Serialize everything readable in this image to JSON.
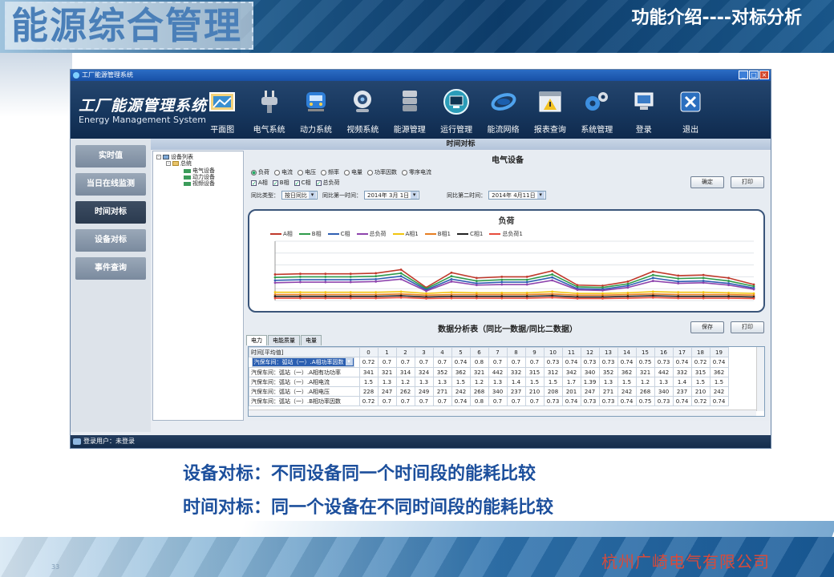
{
  "slide": {
    "brand": "能源综合管理",
    "title": "功能介绍----对标分析",
    "caption1": "设备对标：不同设备同一个时间段的能耗比较",
    "caption2": "时间对标：同一个设备在不同时间段的能耗比较",
    "page_number": "33",
    "company": "杭州广崎电气有限公司"
  },
  "window": {
    "title": "工厂能源管理系统",
    "minimize": "_",
    "maximize": "□",
    "close": "×"
  },
  "header": {
    "logo_cn": "工厂能源管理系统",
    "logo_en": "Energy Management System",
    "nav": [
      {
        "label": "平面图",
        "icon": "floorplan-icon"
      },
      {
        "label": "电气系统",
        "icon": "plug-icon"
      },
      {
        "label": "动力系统",
        "icon": "train-icon"
      },
      {
        "label": "视频系统",
        "icon": "camera-icon"
      },
      {
        "label": "能源管理",
        "icon": "database-icon"
      },
      {
        "label": "运行管理",
        "icon": "monitor-icon"
      },
      {
        "label": "能流网络",
        "icon": "network-icon"
      },
      {
        "label": "报表查询",
        "icon": "report-icon"
      },
      {
        "label": "系统管理",
        "icon": "gears-icon"
      },
      {
        "label": "登录",
        "icon": "login-icon"
      },
      {
        "label": "退出",
        "icon": "exit-icon"
      }
    ]
  },
  "sidebar": {
    "items": [
      {
        "label": "实时值",
        "active": false
      },
      {
        "label": "当日在线监测",
        "active": false
      },
      {
        "label": "时间对标",
        "active": true
      },
      {
        "label": "设备对标",
        "active": false
      },
      {
        "label": "事件查询",
        "active": false
      }
    ]
  },
  "content": {
    "section_title": "时间对标",
    "tree": {
      "root": "设备列表",
      "group": "总统",
      "leaves": [
        "电气设备",
        "动力设备",
        "视频设备"
      ]
    },
    "panel_title": "电气设备",
    "radio_options": [
      "负荷",
      "电流",
      "电压",
      "频率",
      "电量",
      "功率因数",
      "零序电流"
    ],
    "radio_selected": "负荷",
    "checkbox_options": [
      "A相",
      "B相",
      "C相",
      "总负荷"
    ],
    "filter": {
      "type_label": "同比类型：",
      "type_value": "按日同比",
      "first_label": "同比第一时间：",
      "first_value": "2014年 3月 1日",
      "second_label": "同比第二时间：",
      "second_value": "2014年 4月11日"
    },
    "buttons": {
      "confirm": "确定",
      "print": "打印",
      "save": "保存",
      "print2": "打印"
    },
    "table_title": "数据分析表（同比一数据/同比二数据）",
    "tabs": [
      "电力",
      "电能质量",
      "电量"
    ],
    "table": {
      "header_label": "时间[平均值]",
      "hours": [
        "0",
        "1",
        "2",
        "3",
        "4",
        "5",
        "6",
        "7",
        "8",
        "9",
        "10",
        "11",
        "12",
        "13",
        "14",
        "15",
        "16",
        "17",
        "18",
        "19"
      ],
      "rows": [
        {
          "label": "汽保车间：弧站（一）.A相功率因数",
          "values": [
            "0.72",
            "0.7",
            "0.7",
            "0.7",
            "0.7",
            "0.74",
            "0.8",
            "0.7",
            "0.7",
            "0.7",
            "0.73",
            "0.74",
            "0.73",
            "0.73",
            "0.74",
            "0.75",
            "0.73",
            "0.74",
            "0.72",
            "0.74"
          ]
        },
        {
          "label": "汽保车间：弧站（一）.A相有功功率",
          "values": [
            "341",
            "321",
            "314",
            "324",
            "352",
            "362",
            "321",
            "442",
            "332",
            "315",
            "312",
            "342",
            "340",
            "352",
            "362",
            "321",
            "442",
            "332",
            "315",
            "362"
          ]
        },
        {
          "label": "汽保车间：弧站（一）.A相电流",
          "values": [
            "1.5",
            "1.3",
            "1.2",
            "1.3",
            "1.3",
            "1.5",
            "1.2",
            "1.3",
            "1.4",
            "1.5",
            "1.5",
            "1.7",
            "1.39",
            "1.3",
            "1.5",
            "1.2",
            "1.3",
            "1.4",
            "1.5",
            "1.5"
          ]
        },
        {
          "label": "汽保车间：弧站（一）.A相电压",
          "values": [
            "228",
            "247",
            "262",
            "249",
            "271",
            "242",
            "268",
            "340",
            "237",
            "210",
            "208",
            "201",
            "247",
            "271",
            "242",
            "268",
            "340",
            "237",
            "210",
            "242"
          ]
        },
        {
          "label": "汽保车间：弧站（一）.B相功率因数",
          "values": [
            "0.72",
            "0.7",
            "0.7",
            "0.7",
            "0.7",
            "0.74",
            "0.8",
            "0.7",
            "0.7",
            "0.7",
            "0.73",
            "0.74",
            "0.73",
            "0.73",
            "0.74",
            "0.75",
            "0.73",
            "0.74",
            "0.72",
            "0.74"
          ]
        }
      ]
    },
    "status": "登录用户：未登录"
  },
  "chart_data": {
    "type": "line",
    "title": "负荷",
    "legend_position": "top",
    "grid": true,
    "x_count": 20,
    "ylim": [
      0,
      10
    ],
    "series": [
      {
        "name": "A相",
        "color": "#c0392b",
        "values": [
          4.4,
          4.5,
          4.5,
          4.5,
          4.6,
          5.2,
          2.2,
          4.7,
          3.8,
          4.0,
          4.0,
          5.0,
          2.6,
          2.5,
          3.2,
          4.9,
          4.2,
          4.3,
          3.8,
          2.7
        ]
      },
      {
        "name": "B相",
        "color": "#2e9b4a",
        "values": [
          3.9,
          4.0,
          4.0,
          4.0,
          4.1,
          4.6,
          2.0,
          4.1,
          3.3,
          3.5,
          3.5,
          4.4,
          2.3,
          2.2,
          2.8,
          4.3,
          3.7,
          3.8,
          3.3,
          2.4
        ]
      },
      {
        "name": "C相",
        "color": "#2f5fb3",
        "values": [
          3.4,
          3.5,
          3.5,
          3.5,
          3.6,
          4.1,
          1.8,
          3.6,
          2.9,
          3.1,
          3.1,
          3.9,
          2.0,
          1.9,
          2.5,
          3.8,
          3.2,
          3.3,
          2.9,
          2.1
        ]
      },
      {
        "name": "总负荷",
        "color": "#8e44ad",
        "values": [
          3.0,
          3.1,
          3.1,
          3.1,
          3.2,
          3.6,
          1.6,
          3.2,
          2.6,
          2.7,
          2.7,
          3.4,
          1.8,
          1.7,
          2.2,
          3.3,
          2.9,
          3.0,
          2.6,
          1.9
        ]
      },
      {
        "name": "A相1",
        "color": "#f1c40f",
        "values": [
          1.4,
          1.4,
          1.4,
          1.4,
          1.4,
          1.5,
          1.2,
          1.4,
          1.3,
          1.3,
          1.3,
          1.5,
          1.2,
          1.2,
          1.3,
          1.5,
          1.4,
          1.4,
          1.3,
          1.2
        ]
      },
      {
        "name": "B相1",
        "color": "#e67e22",
        "values": [
          1.0,
          1.0,
          1.0,
          1.0,
          1.0,
          1.1,
          0.9,
          1.0,
          1.0,
          1.0,
          1.0,
          1.1,
          0.9,
          0.9,
          1.0,
          1.1,
          1.0,
          1.0,
          1.0,
          0.9
        ]
      },
      {
        "name": "C相1",
        "color": "#222222",
        "values": [
          0.7,
          0.7,
          0.7,
          0.7,
          0.7,
          0.8,
          0.6,
          0.7,
          0.7,
          0.7,
          0.7,
          0.8,
          0.6,
          0.6,
          0.7,
          0.8,
          0.7,
          0.7,
          0.7,
          0.6
        ]
      },
      {
        "name": "总负荷1",
        "color": "#e74c3c",
        "values": [
          0.4,
          0.4,
          0.4,
          0.4,
          0.4,
          0.5,
          0.35,
          0.4,
          0.4,
          0.4,
          0.4,
          0.5,
          0.35,
          0.35,
          0.4,
          0.5,
          0.4,
          0.4,
          0.4,
          0.35
        ]
      }
    ]
  }
}
